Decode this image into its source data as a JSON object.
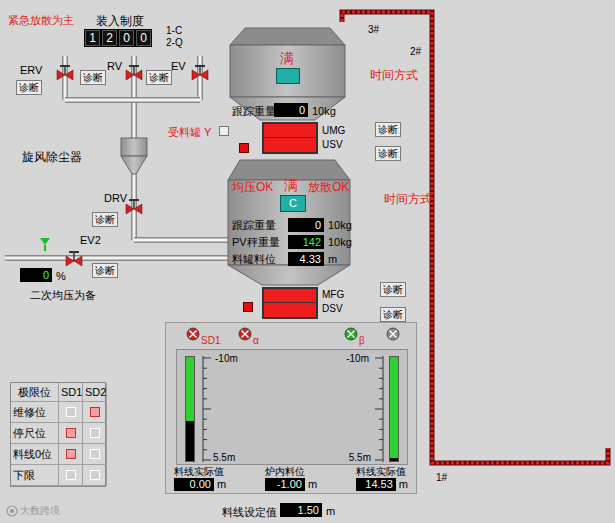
{
  "header": {
    "mode_note": "紧急放散为主",
    "charge_title": "装入制度",
    "charge_digits": [
      "1",
      "2",
      "0",
      "0"
    ],
    "charge_legend": [
      "1-C",
      "2-Q"
    ]
  },
  "diag_label": "诊断",
  "valves": [
    {
      "name": "ERV",
      "open": false
    },
    {
      "name": "RV",
      "open": false
    },
    {
      "name": "EV",
      "open": false
    },
    {
      "name": "DRV",
      "open": false
    },
    {
      "name": "EV2",
      "open": false
    }
  ],
  "cyclone": "旋风除尘器",
  "secondary_eq": {
    "value": "0",
    "unit": "%",
    "note": "二次均压为备",
    "on": true
  },
  "upper_hopper": {
    "status": "满",
    "track_label": "跟踪重量",
    "track_value": "0",
    "unit": "10kg"
  },
  "receive_tank": {
    "label": "受料罐 Y",
    "checked": false
  },
  "upper_gate": {
    "labels": [
      "UMG",
      "USV"
    ],
    "active": true
  },
  "time_mode": [
    "时间方式",
    "时间方式"
  ],
  "conveyor": [
    "3#",
    "2#",
    "1#"
  ],
  "lower_hopper": {
    "eq_ok": "均压OK",
    "status": "满",
    "vent_ok": "放散OK",
    "code": "C",
    "rows": [
      {
        "label": "跟踪重量",
        "value": "0",
        "unit": "10kg",
        "color": "#ffffff"
      },
      {
        "label": "PV秤重量",
        "value": "142",
        "unit": "10kg",
        "color": "#33ff33"
      },
      {
        "label": "料罐料位",
        "value": "4.33",
        "unit": "m",
        "color": "#ffffff"
      }
    ]
  },
  "lower_gate": {
    "labels": [
      "MFG",
      "DSV"
    ],
    "active": true
  },
  "probes": [
    {
      "label": "SD1",
      "color": "#cc2222"
    },
    {
      "label": "α",
      "color": "#cc2222"
    },
    {
      "label": "β",
      "color": "#22aa22"
    },
    {
      "color": "#8a8a8a"
    }
  ],
  "gauges": [
    {
      "top": "-10m",
      "bottom": "5.5m",
      "level": 0.62
    },
    {
      "top": "-10m",
      "bottom": "5.5m",
      "level": 0.97
    }
  ],
  "readouts": [
    {
      "label": "料线实际值",
      "value": "0.00",
      "unit": "m"
    },
    {
      "label": "炉内料位",
      "value": "-1.00",
      "unit": "m"
    },
    {
      "label": "料线实际值",
      "value": "14.53",
      "unit": "m"
    }
  ],
  "setpoint": {
    "label": "料线设定值",
    "value": "1.50",
    "unit": "m"
  },
  "limits": {
    "columns": [
      "极限位",
      "SD1",
      "SD2"
    ],
    "rows": [
      {
        "label": "维修位",
        "sd1": false,
        "sd2": true
      },
      {
        "label": "停尺位",
        "sd1": true,
        "sd2": false
      },
      {
        "label": "料线0位",
        "sd1": true,
        "sd2": false
      },
      {
        "label": "下限",
        "sd1": false,
        "sd2": false
      }
    ]
  },
  "watermark": "大数跨境"
}
